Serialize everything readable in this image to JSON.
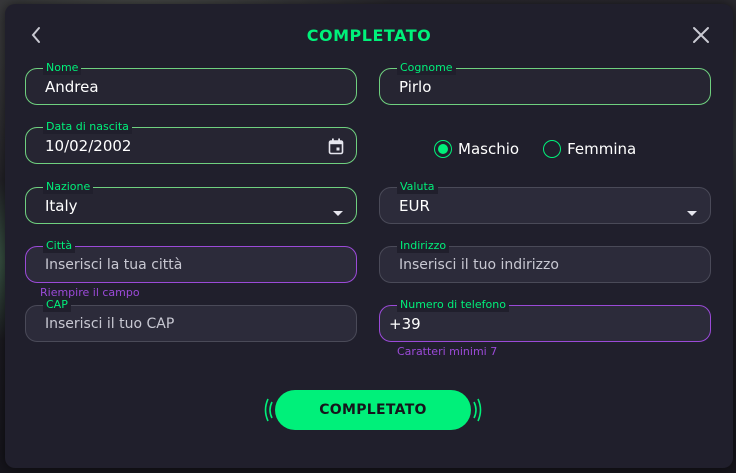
{
  "header": {
    "title": "COMPLETATO"
  },
  "fields": {
    "nome": {
      "label": "Nome",
      "value": "Andrea"
    },
    "cognome": {
      "label": "Cognome",
      "value": "Pirlo"
    },
    "data": {
      "label": "Data di nascita",
      "value": "10/02/2002",
      "icon": "calendar-icon"
    },
    "nazione": {
      "label": "Nazione",
      "value": "Italy",
      "icon": "dropdown-caret-icon"
    },
    "valuta": {
      "label": "Valuta",
      "value": "EUR",
      "icon": "dropdown-caret-icon"
    },
    "citta": {
      "label": "Città",
      "placeholder": "Inserisci la tua città",
      "helper": "Riempire il campo"
    },
    "indirizzo": {
      "label": "Indirizzo",
      "placeholder": "Inserisci il tuo indirizzo"
    },
    "cap": {
      "label": "CAP",
      "placeholder": "Inserisci il tuo CAP"
    },
    "telefono": {
      "label": "Numero di telefono",
      "value": "+39",
      "helper": "Caratteri minimi 7"
    }
  },
  "gender": {
    "options": [
      {
        "label": "Maschio",
        "selected": true
      },
      {
        "label": "Femmina",
        "selected": false
      }
    ]
  },
  "actions": {
    "submit_label": "COMPLETATO"
  },
  "colors": {
    "accent": "#00f07a",
    "error": "#9b4ad8",
    "background": "#201f2c"
  }
}
